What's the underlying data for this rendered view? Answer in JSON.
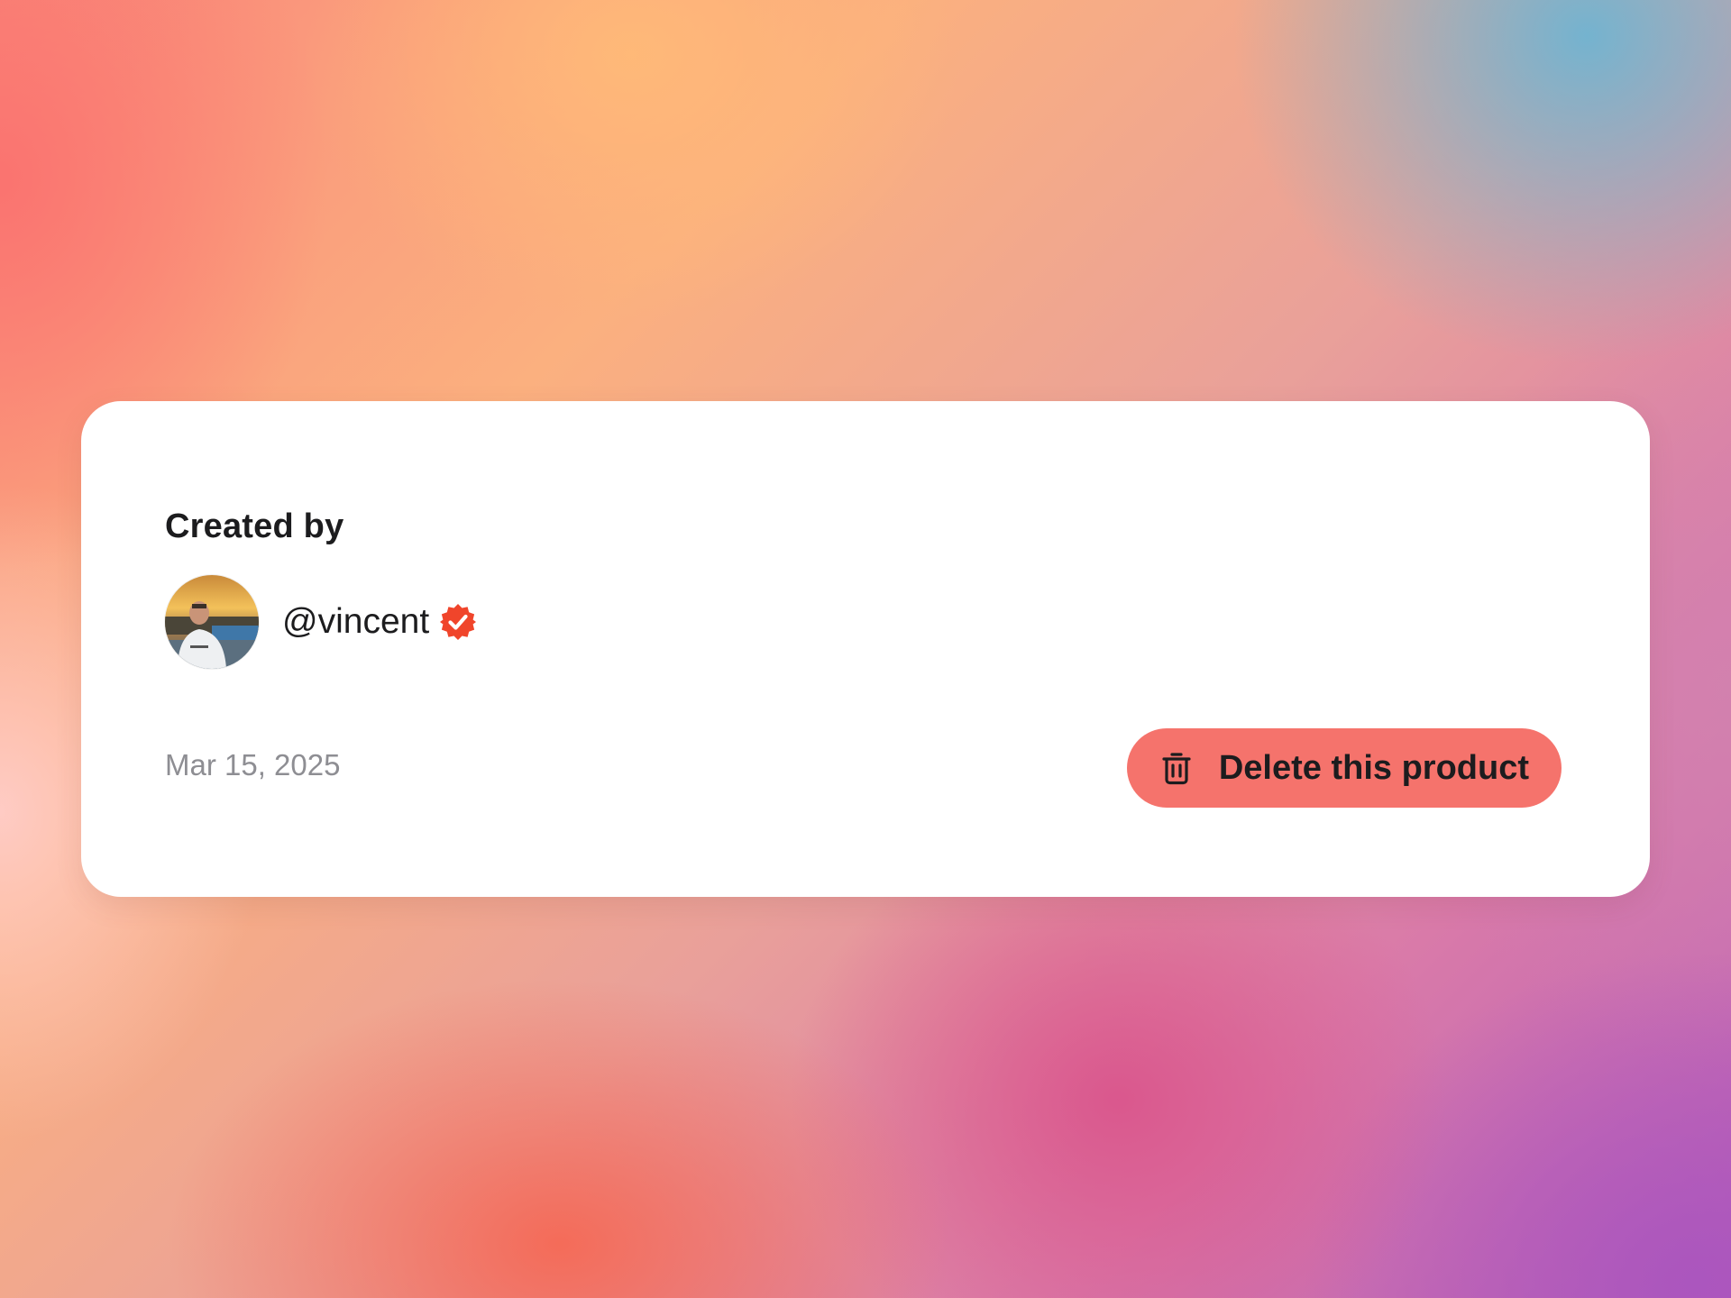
{
  "card": {
    "created_by_label": "Created by",
    "author": {
      "username": "@vincent",
      "verified": true,
      "avatar_icon": "user-photo-avatar"
    },
    "date": "Mar 15, 2025",
    "delete_button": {
      "label": "Delete this product",
      "icon": "trash-icon"
    }
  },
  "colors": {
    "card_background": "#ffffff",
    "danger_button": "#f5736c",
    "verified_badge": "#f0452b",
    "muted_text": "#8e8e93",
    "primary_text": "#1c1c1e"
  }
}
